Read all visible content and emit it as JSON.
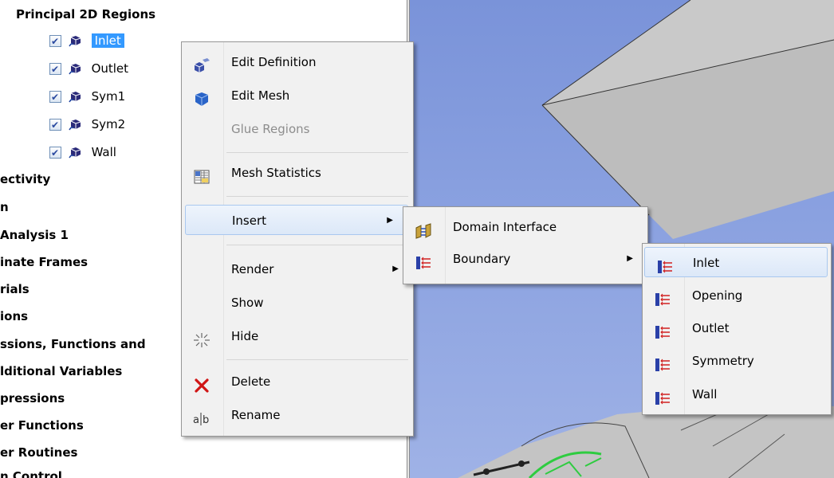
{
  "tree": {
    "header": "Principal 2D Regions",
    "regions": [
      {
        "label": "Inlet",
        "checked": true,
        "selected": true
      },
      {
        "label": "Outlet",
        "checked": true
      },
      {
        "label": "Sym1",
        "checked": true
      },
      {
        "label": "Sym2",
        "checked": true
      },
      {
        "label": "Wall",
        "checked": true
      }
    ],
    "items": [
      "ectivity",
      "n",
      "Analysis 1",
      "inate Frames",
      "rials",
      "ions",
      "ssions, Functions and",
      "lditional Variables",
      "pressions",
      "er Functions",
      "er Routines",
      "n Control"
    ],
    "selection_color": "#3399ff"
  },
  "context_menu": {
    "items": [
      {
        "label": "Edit Definition",
        "icon": "edit-definition-icon"
      },
      {
        "label": "Edit Mesh",
        "icon": "edit-mesh-icon"
      },
      {
        "label": "Glue Regions",
        "disabled": true
      },
      {
        "label": "Mesh Statistics",
        "icon": "mesh-statistics-icon"
      },
      {
        "label": "Insert",
        "submenu": true,
        "highlighted": true
      },
      {
        "label": "Render",
        "submenu": true
      },
      {
        "label": "Show"
      },
      {
        "label": "Hide",
        "icon": "hide-icon"
      },
      {
        "label": "Delete",
        "icon": "delete-icon"
      },
      {
        "label": "Rename",
        "icon": "rename-icon"
      }
    ]
  },
  "insert_submenu": {
    "items": [
      {
        "label": "Domain Interface",
        "icon": "domain-interface-icon"
      },
      {
        "label": "Boundary",
        "icon": "boundary-icon",
        "submenu": true
      }
    ]
  },
  "boundary_submenu": {
    "items": [
      {
        "label": "Inlet",
        "highlighted": true
      },
      {
        "label": "Opening"
      },
      {
        "label": "Outlet"
      },
      {
        "label": "Symmetry"
      },
      {
        "label": "Wall"
      }
    ]
  },
  "arrow_glyph": "▶"
}
